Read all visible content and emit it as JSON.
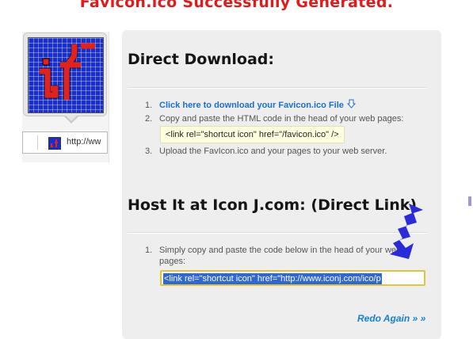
{
  "page": {
    "title": "Favicon.ico Successfully Generated."
  },
  "preview": {
    "address_text": "http://ww",
    "icon_name": "jf-favicon-icon"
  },
  "direct_download": {
    "heading": "Direct Download:",
    "items": [
      {
        "num": "1.",
        "link_text": "Click here to download your Favicon.ico File",
        "icon": "download-arrow-icon"
      },
      {
        "num": "2.",
        "text": "Copy and paste the HTML code in the head of your web pages:"
      },
      {
        "num": "3.",
        "text": "Upload the FavIcon.ico and your pages to your web server."
      }
    ],
    "code": "<link rel=\"shortcut icon\" href=\"/favicon.ico\" />"
  },
  "hosted": {
    "heading": "Host It at Icon J.com: (Direct Link)",
    "items": [
      {
        "num": "1.",
        "text_line1": "Simply copy and paste the code below in the head of your web",
        "text_line2": "pages:"
      }
    ],
    "code_value": "<link rel=\"shortcut icon\" href=\"http://www.iconj.com/ico/p"
  },
  "footer": {
    "redo_label": "Redo Again » »"
  },
  "colors": {
    "title": "#e01b1b",
    "link": "#1a6fcf",
    "icon_bg": "#1a2fc8",
    "icon_fg": "#e0231d",
    "arrow": "#2a2ad8"
  }
}
